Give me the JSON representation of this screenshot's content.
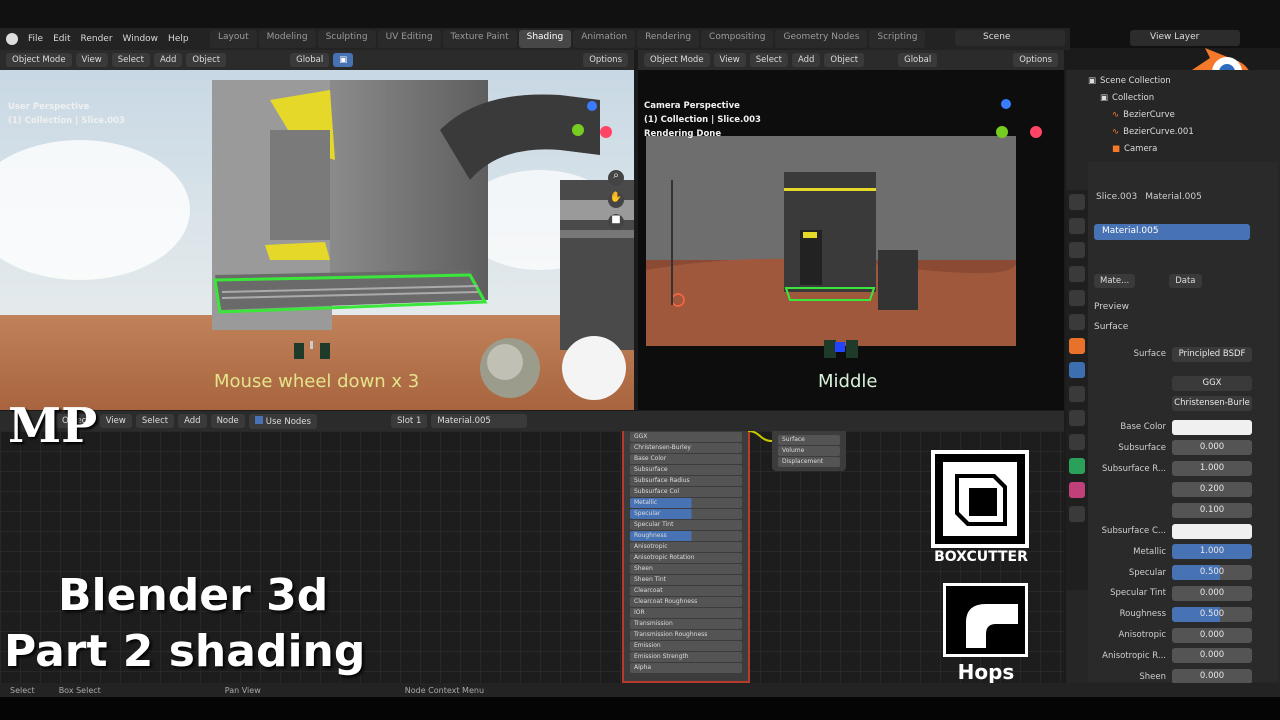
{
  "menu": {
    "items": [
      "File",
      "Edit",
      "Render",
      "Window",
      "Help"
    ]
  },
  "workspaces": [
    "Layout",
    "Modeling",
    "Sculpting",
    "UV Editing",
    "Texture Paint",
    "Shading",
    "Animation",
    "Rendering",
    "Compositing",
    "Geometry Nodes",
    "Scripting"
  ],
  "active_workspace": "Shading",
  "scene": "Scene",
  "view_layer": "View Layer",
  "viewport_left": {
    "mode": "Object Mode",
    "view": "View",
    "select": "Select",
    "add": "Add",
    "object": "Object",
    "orientation": "Global",
    "options": "Options",
    "line1": "User Perspective",
    "line2": "(1) Collection | Slice.003",
    "caption": "Mouse wheel down x 3"
  },
  "viewport_right": {
    "mode": "Object Mode",
    "view": "View",
    "select": "Select",
    "add": "Add",
    "object": "Object",
    "orientation": "Global",
    "options": "Options",
    "line1": "Camera Perspective",
    "line2": "(1) Collection | Slice.003",
    "line3": "Rendering Done",
    "caption": "Middle"
  },
  "node_editor": {
    "object": "Object",
    "view": "View",
    "select": "Select",
    "add": "Add",
    "node": "Node",
    "use_nodes": "Use Nodes",
    "slot": "Slot 1",
    "material": "Material.005",
    "bsdf_rows": [
      "GGX",
      "Christensen-Burley",
      "Base Color",
      "Subsurface",
      "Subsurface Radius",
      "Subsurface Col",
      "Metallic",
      "Specular",
      "Specular Tint",
      "Roughness",
      "Anisotropic",
      "Anisotropic Rotation",
      "Sheen",
      "Sheen Tint",
      "Clearcoat",
      "Clearcoat Roughness",
      "IOR",
      "Transmission",
      "Transmission Roughness",
      "Emission",
      "Emission Strength",
      "Alpha"
    ],
    "output_rows": [
      "Surface",
      "Volume",
      "Displacement"
    ]
  },
  "outliner": {
    "root": "Scene Collection",
    "collection": "Collection",
    "items": [
      "BezierCurve",
      "BezierCurve.001",
      "Camera"
    ]
  },
  "properties": {
    "object": "Slice.003",
    "material": "Material.005",
    "slot": "Material.005",
    "mat_short": "Mate...",
    "data": "Data",
    "preview": "Preview",
    "surface_panel": "Surface",
    "surface_label": "Surface",
    "surface_value": "Principled BSDF",
    "distribution": "GGX",
    "subsurface_method": "Christensen-Burle",
    "rows": [
      {
        "label": "Base Color",
        "value": "",
        "kind": "white"
      },
      {
        "label": "Subsurface",
        "value": "0.000",
        "kind": "grey"
      },
      {
        "label": "Subsurface R...",
        "value": "1.000",
        "kind": "grey"
      },
      {
        "label": "",
        "value": "0.200",
        "kind": "grey"
      },
      {
        "label": "",
        "value": "0.100",
        "kind": "grey"
      },
      {
        "label": "Subsurface C...",
        "value": "",
        "kind": "white"
      },
      {
        "label": "Metallic",
        "value": "1.000",
        "kind": "bluefull"
      },
      {
        "label": "Specular",
        "value": "0.500",
        "kind": "blue"
      },
      {
        "label": "Specular Tint",
        "value": "0.000",
        "kind": "grey"
      },
      {
        "label": "Roughness",
        "value": "0.500",
        "kind": "blue"
      },
      {
        "label": "Anisotropic",
        "value": "0.000",
        "kind": "grey"
      },
      {
        "label": "Anisotropic R...",
        "value": "0.000",
        "kind": "grey"
      },
      {
        "label": "Sheen",
        "value": "0.000",
        "kind": "grey"
      }
    ]
  },
  "status": {
    "select": "Select",
    "box_select": "Box Select",
    "pan_view": "Pan View",
    "node_context": "Node Context Menu"
  },
  "overlay": {
    "title1": "Blender 3d",
    "title2": "Part 2 shading",
    "boxcutter": "BOXCUTTER",
    "hops": "Hops",
    "watermark": "MP"
  },
  "colors": {
    "accent": "#4772b3",
    "highlight_green": "#39e639",
    "caption_yellow": "#e4e48a",
    "blender_orange": "#f5792a"
  }
}
